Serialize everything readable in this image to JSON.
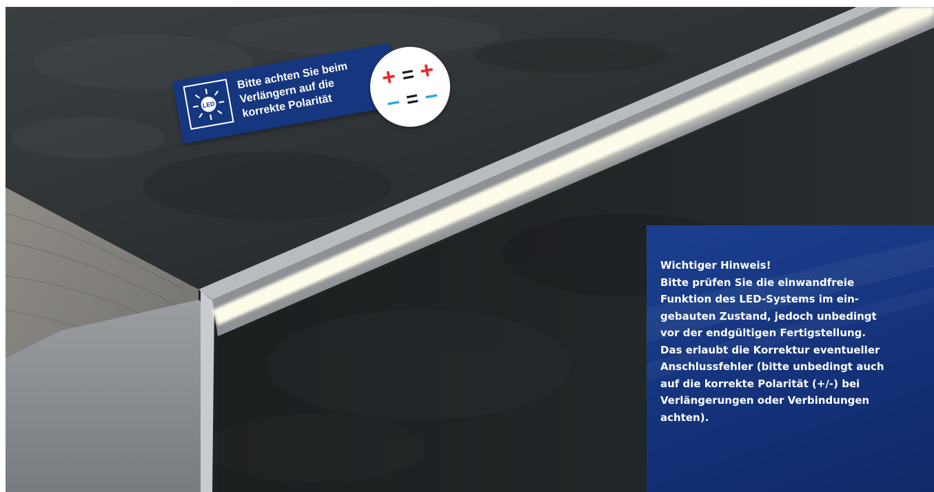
{
  "scene": {
    "icons": {
      "led": "led-bulb-icon",
      "plus": "plus-icon",
      "minus": "minus-icon",
      "equals": "equals-icon"
    },
    "colors": {
      "banner_blue": "#16377f",
      "panel_blue": "#163680",
      "plus_red": "#e32b2b",
      "minus_cyan": "#28a8e0",
      "led_light": "#fffbea"
    }
  },
  "polarity_note": {
    "icon_label": "LED",
    "text": "Bitte achten Sie beim\nVerlängern auf die\nkorrekte Polarität",
    "plus_symbol": "+",
    "minus_symbol": "–",
    "equals_symbol": "="
  },
  "notice": {
    "text": "Wichtiger Hinweis!\nBitte prüfen Sie die einwandfreie\nFunktion des LED-Systems im ein-\ngebauten Zustand, jedoch unbedingt\nvor der endgültigen Fertigstellung.\nDas erlaubt die Korrektur eventueller\nAnschlussfehler (bitte unbedingt auch\nauf die korrekte Polarität (+/-) bei\nVerlängerungen oder Verbindungen\nachten)."
  }
}
